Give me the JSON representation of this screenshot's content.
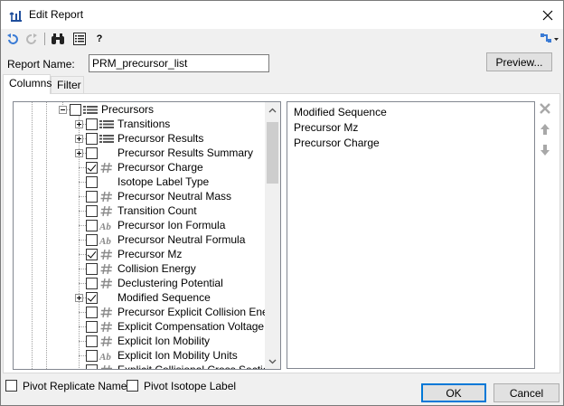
{
  "window": {
    "title": "Edit Report"
  },
  "toolbar": {
    "undo": "undo-icon",
    "redo": "redo-icon",
    "find": "binoculars-icon",
    "list": "list-icon",
    "help_label": "?",
    "settings": "settings-icon"
  },
  "report_name": {
    "label": "Report Name:",
    "value": "PRM_precursor_list"
  },
  "preview_label": "Preview...",
  "tabs": [
    {
      "label": "Columns"
    },
    {
      "label": "Filter"
    }
  ],
  "tree": {
    "items": [
      {
        "label": "Precursors"
      },
      {
        "label": "Transitions"
      },
      {
        "label": "Precursor Results"
      },
      {
        "label": "Precursor Results Summary"
      },
      {
        "label": "Precursor Charge"
      },
      {
        "label": "Isotope Label Type"
      },
      {
        "label": "Precursor Neutral Mass"
      },
      {
        "label": "Transition Count"
      },
      {
        "label": "Precursor Ion Formula"
      },
      {
        "label": "Precursor Neutral Formula"
      },
      {
        "label": "Precursor Mz"
      },
      {
        "label": "Collision Energy"
      },
      {
        "label": "Declustering Potential"
      },
      {
        "label": "Modified Sequence"
      },
      {
        "label": "Precursor Explicit Collision Energy"
      },
      {
        "label": "Explicit Compensation Voltage"
      },
      {
        "label": "Explicit Ion Mobility"
      },
      {
        "label": "Explicit Ion Mobility Units"
      },
      {
        "label": "Explicit Collisional Cross Section"
      }
    ]
  },
  "selected_columns": {
    "items": [
      {
        "label": "Modified Sequence"
      },
      {
        "label": "Precursor Mz"
      },
      {
        "label": "Precursor Charge"
      }
    ]
  },
  "options": {
    "pivot_replicate": {
      "label": "Pivot Replicate Name",
      "checked": false
    },
    "pivot_isotope": {
      "label": "Pivot Isotope Label",
      "checked": false
    }
  },
  "ok_label": "OK",
  "cancel_label": "Cancel",
  "colors": {
    "accent": "#0078d7",
    "icon_blue": "#3a7bd5",
    "number_icon_gray": "#8a8a8a"
  }
}
